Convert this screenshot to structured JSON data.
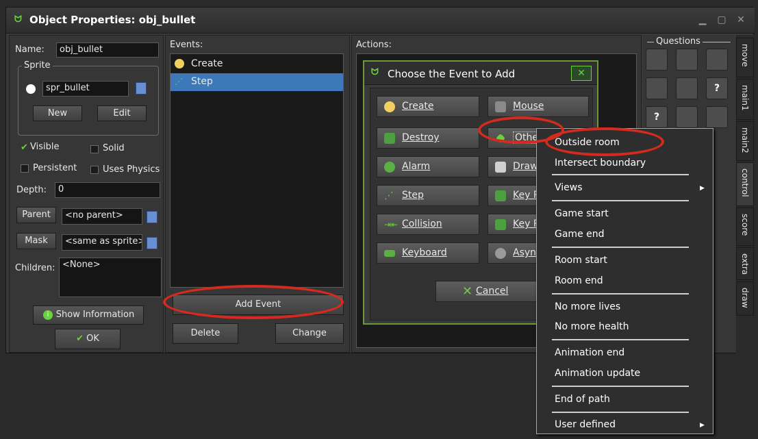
{
  "window": {
    "title": "Object Properties: obj_bullet"
  },
  "left": {
    "name_label": "Name:",
    "name_value": "obj_bullet",
    "sprite_group_label": "Sprite",
    "sprite_value": "spr_bullet",
    "new_label": "New",
    "edit_label": "Edit",
    "visible_label": "Visible",
    "solid_label": "Solid",
    "persistent_label": "Persistent",
    "uses_physics_label": "Uses Physics",
    "depth_label": "Depth:",
    "depth_value": "0",
    "parent_label": "Parent",
    "parent_value": "<no parent>",
    "mask_label": "Mask",
    "mask_value": "<same as sprite>",
    "children_label": "Children:",
    "children_value": "<None>",
    "show_info_label": "Show Information",
    "ok_label": "OK"
  },
  "events": {
    "label": "Events:",
    "items": [
      {
        "label": "Create"
      },
      {
        "label": "Step"
      }
    ],
    "add_label": "Add Event",
    "delete_label": "Delete",
    "change_label": "Change"
  },
  "actions": {
    "label": "Actions:"
  },
  "dialog": {
    "title": "Choose the Event to Add",
    "buttons": [
      {
        "label": "Create"
      },
      {
        "label": "Mouse"
      },
      {
        "label": "Destroy"
      },
      {
        "label": "Othe"
      },
      {
        "label": "Alarm"
      },
      {
        "label": "Draw"
      },
      {
        "label": "Step"
      },
      {
        "label": "Key P"
      },
      {
        "label": "Collision"
      },
      {
        "label": "Key R"
      },
      {
        "label": "Keyboard"
      },
      {
        "label": "Asyn"
      }
    ],
    "cancel_label": "Cancel"
  },
  "right": {
    "group_label": "Questions",
    "tabs": [
      "move",
      "main1",
      "main2",
      "control",
      "score",
      "extra",
      "draw"
    ]
  },
  "context_menu": {
    "items": [
      "Outside room",
      "Intersect boundary",
      "Views",
      "Game start",
      "Game end",
      "Room start",
      "Room end",
      "No more lives",
      "No more health",
      "Animation end",
      "Animation update",
      "End of path",
      "User defined"
    ]
  },
  "colors": {
    "accent": "#6cd040",
    "highlight": "#d42b1e",
    "selection": "#3d78b8"
  }
}
